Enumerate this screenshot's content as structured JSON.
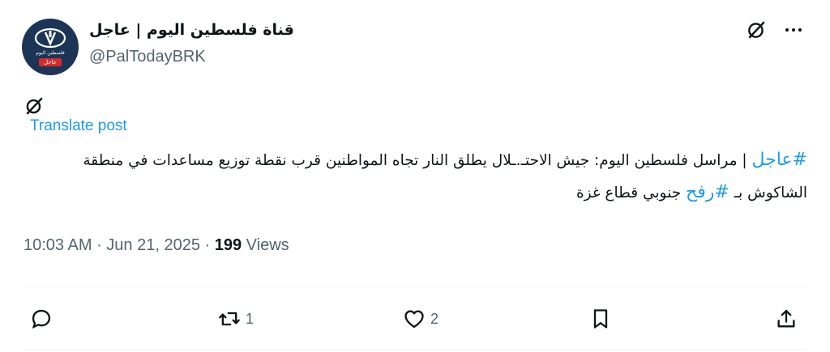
{
  "account": {
    "display_name": "قناة فلسطين اليوم | عاجل",
    "handle": "@PalTodayBRK",
    "avatar_badge": "عاجل",
    "avatar_caption": "فلسطين اليوم"
  },
  "post": {
    "translate_label": "Translate post",
    "text_parts": {
      "hashtag1": "#عاجل",
      "text1": " | مراسل فلسطين اليوم: جيش الاحتـ.ـلال يطلق النار تجاه المواطنين قرب نقطة توزيع مساعدات في منطقة الشاكوش بـ ",
      "hashtag2": "#رفح",
      "text2": " جنوبي قطاع غزة"
    },
    "time": "10:03 AM",
    "sep1": " · ",
    "date": "Jun 21, 2025",
    "sep2": " · ",
    "views_count": "199",
    "views_label": " Views"
  },
  "actions": {
    "reply_count": "",
    "repost_count": "1",
    "like_count": "2"
  },
  "icons": {
    "top_grok": "grok-icon",
    "more": "more-icon",
    "reply": "reply-icon",
    "repost": "repost-icon",
    "like": "like-icon",
    "bookmark": "bookmark-icon",
    "share": "share-icon"
  },
  "colors": {
    "link": "#1d9bf0",
    "muted": "#536471",
    "text": "#0f1419",
    "avatar_bg": "#1c3557",
    "badge": "#d62a2a"
  }
}
